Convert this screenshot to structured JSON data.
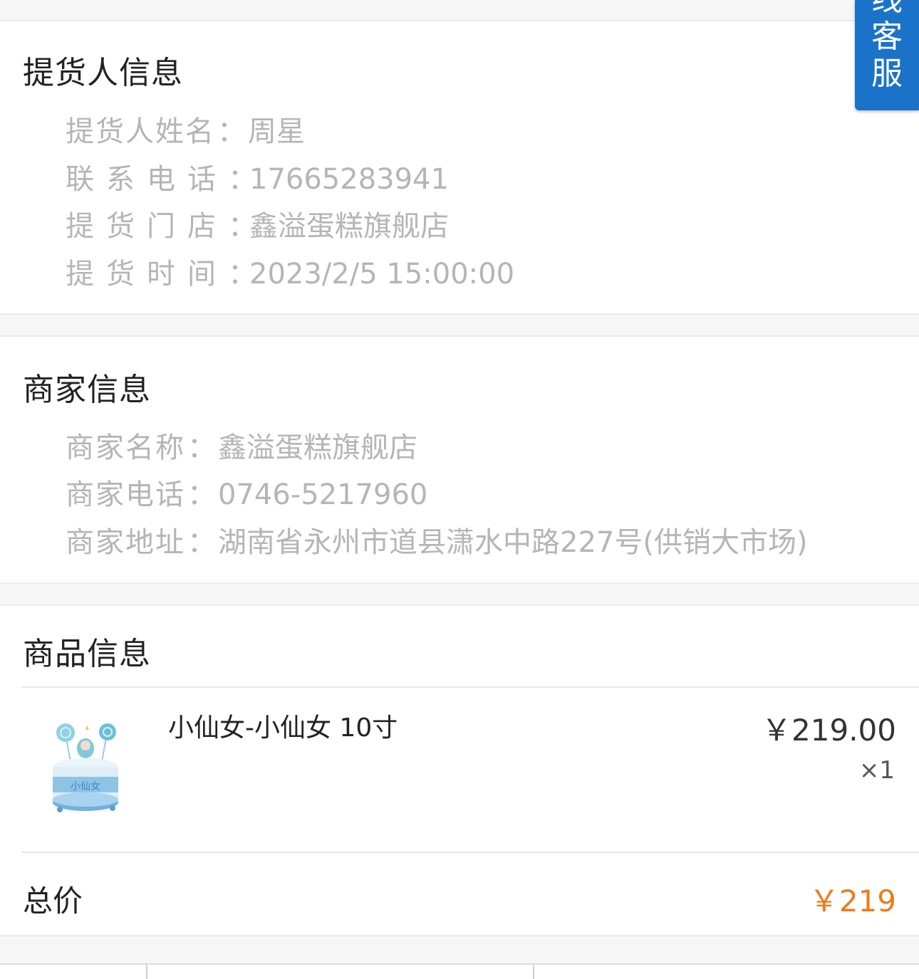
{
  "customer_service": {
    "chars": [
      "线",
      "客",
      "服"
    ]
  },
  "pickup": {
    "title": "提货人信息",
    "name_label": "提货人姓名",
    "name_value": "周星",
    "phone_label": "联系电话",
    "phone_value": "17665283941",
    "store_label": "提货门店",
    "store_value": "鑫溢蛋糕旗舰店",
    "time_label": "提货时间",
    "time_value": "2023/2/5 15:00:00"
  },
  "merchant": {
    "title": "商家信息",
    "name_label": "商家名称",
    "name_value": "鑫溢蛋糕旗舰店",
    "phone_label": "商家电话",
    "phone_value": "0746-5217960",
    "address_label": "商家地址",
    "address_value": "湖南省永州市道县潇水中路227号(供销大市场)"
  },
  "goods": {
    "title": "商品信息",
    "product_name": "小仙女-小仙女 10寸",
    "price": "￥219.00",
    "quantity": "×1",
    "image_text": "小仙女",
    "total_label": "总价",
    "total_value": "￥219"
  },
  "colors": {
    "accent_orange": "#ef7a1a",
    "service_blue": "#1a73c8"
  }
}
